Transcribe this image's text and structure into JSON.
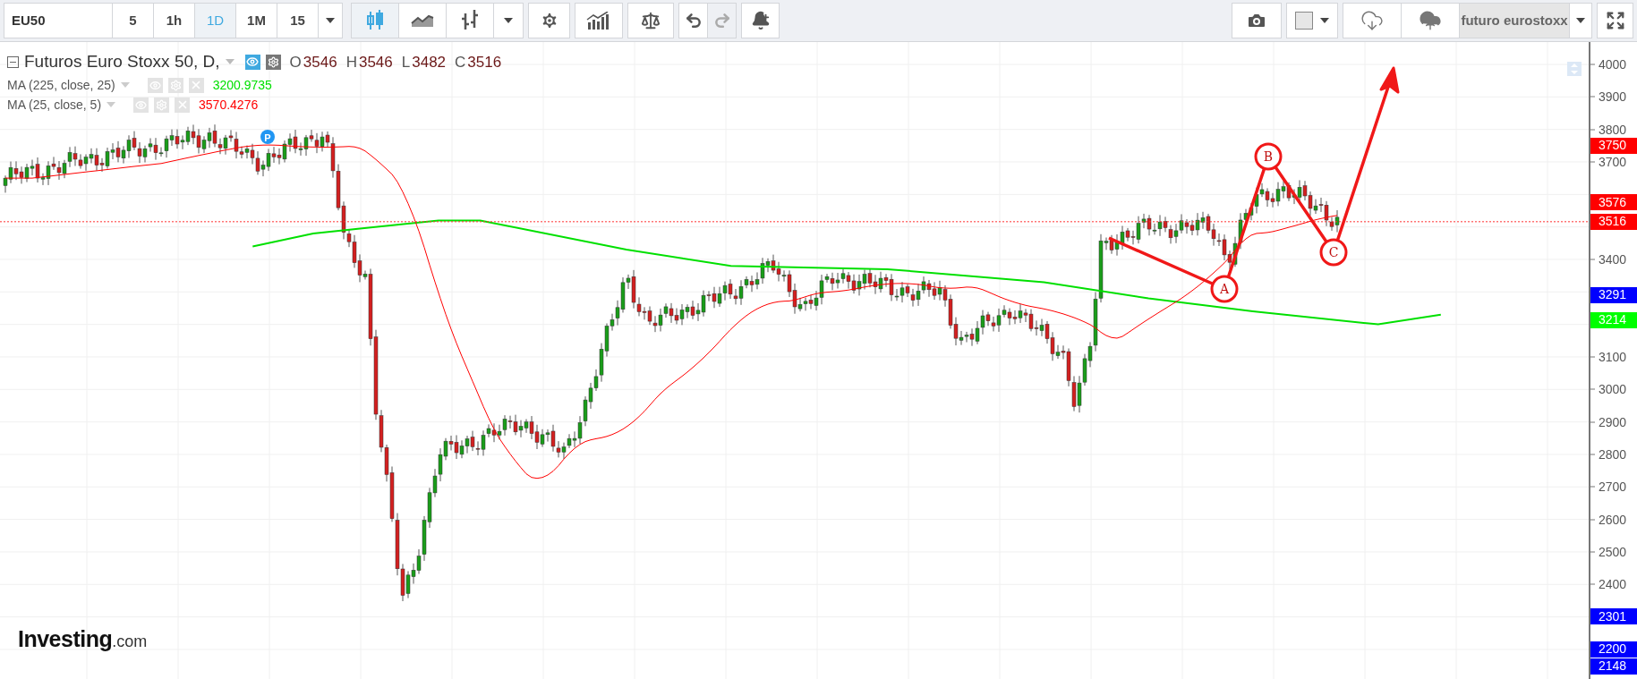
{
  "toolbar": {
    "symbol": "EU50",
    "intervals": [
      {
        "label": "5",
        "selected": false
      },
      {
        "label": "1h",
        "selected": false
      },
      {
        "label": "1D",
        "selected": true
      },
      {
        "label": "1M",
        "selected": false
      },
      {
        "label": "15",
        "selected": false
      }
    ],
    "chart_types": [
      {
        "kind": "candles",
        "selected": true
      },
      {
        "kind": "area",
        "selected": false
      },
      {
        "kind": "bars",
        "selected": false
      }
    ],
    "history": [
      {
        "kind": "undo",
        "disabled": false
      },
      {
        "kind": "redo",
        "disabled": true
      }
    ],
    "layout_name": "futuro eurostoxx"
  },
  "legend": {
    "title": "Futuros Euro Stoxx 50, D,",
    "ohlc": [
      {
        "letter": "O",
        "value": "3546"
      },
      {
        "letter": "H",
        "value": "3546"
      },
      {
        "letter": "L",
        "value": "3482"
      },
      {
        "letter": "C",
        "value": "3516"
      }
    ],
    "indicators": [
      {
        "name": "MA (225, close, 25)",
        "value": "3200.9735",
        "color": "#00e000"
      },
      {
        "name": "MA (25, close, 5)",
        "value": "3570.4276",
        "color": "#ff0000"
      }
    ]
  },
  "chart": {
    "marker": "P",
    "wave_labels": [
      "A",
      "B",
      "C"
    ]
  },
  "price_axis": {
    "ticks": [
      "4000",
      "3900",
      "3800",
      "3700",
      "3400",
      "3100",
      "3000",
      "2900",
      "2800",
      "2700",
      "2600",
      "2500",
      "2400"
    ],
    "tags": [
      {
        "label": "3750",
        "color": "#ff0000"
      },
      {
        "label": "3576",
        "color": "#ff0000"
      },
      {
        "label": "3516",
        "color": "#ff0000"
      },
      {
        "label": "3291",
        "color": "#0000ff"
      },
      {
        "label": "3214",
        "color": "#00ff00"
      },
      {
        "label": "2301",
        "color": "#0000ff"
      },
      {
        "label": "2200",
        "color": "#0000ff"
      },
      {
        "label": "2148",
        "color": "#0000ff"
      }
    ]
  },
  "logo": {
    "name": "Investing",
    "suffix": ".com"
  }
}
